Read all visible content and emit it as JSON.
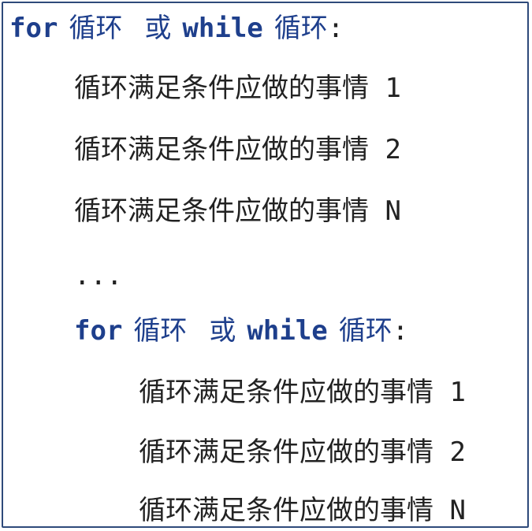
{
  "outer_loop": {
    "keyword_for": "for",
    "loop_word_1": "循环",
    "or_word": "或",
    "keyword_while": "while",
    "loop_word_2": "循环",
    "colon": ":"
  },
  "outer_body": [
    "循环满足条件应做的事情 1",
    "循环满足条件应做的事情 2",
    "循环满足条件应做的事情 N"
  ],
  "ellipsis": "...",
  "inner_loop": {
    "keyword_for": "for",
    "loop_word_1": "循环",
    "or_word": "或",
    "keyword_while": "while",
    "loop_word_2": "循环",
    "colon": ":"
  },
  "inner_body": [
    "循环满足条件应做的事情 1",
    "循环满足条件应做的事情 2",
    "循环满足条件应做的事情 N"
  ],
  "colors": {
    "keyword": "#1e3f8c",
    "text": "#222222",
    "border": "#2e4a7a"
  }
}
